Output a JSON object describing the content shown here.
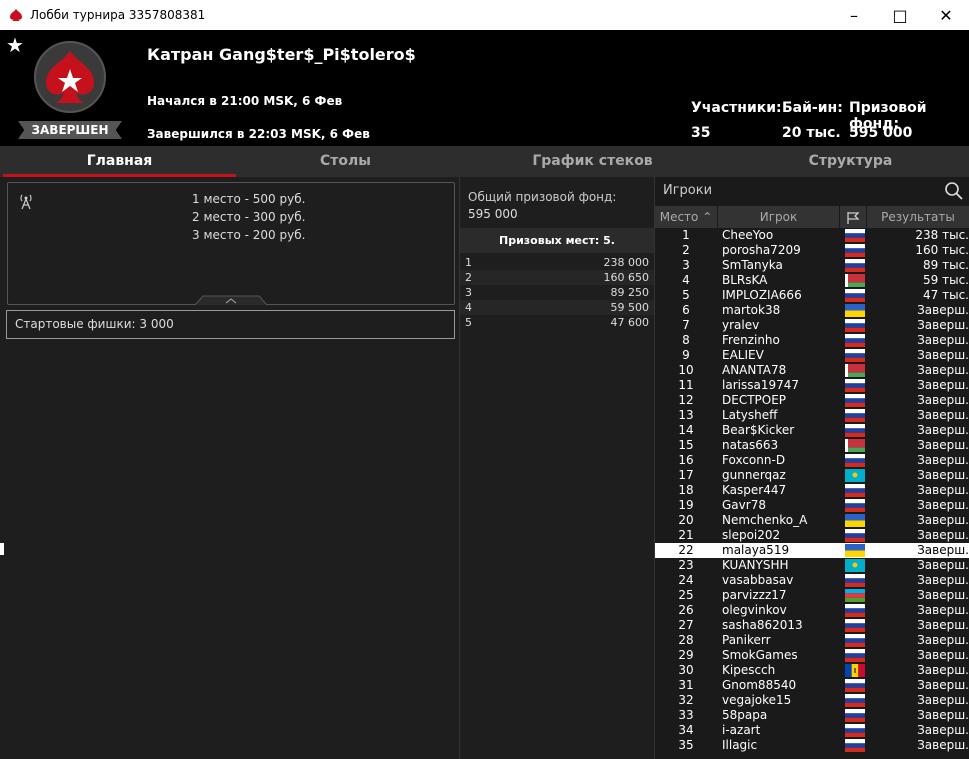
{
  "window": {
    "title": "Лобби турнира 3357808381"
  },
  "tournament": {
    "name": "Катран Gang$ter$_Pi$tolero$",
    "status": "ЗАВЕРШЕН",
    "started": "Начался в 21:00 MSK, 6 Фев",
    "ended": "Завершился в 22:03 MSK, 6 Фев",
    "participants_label": "Участники:",
    "participants": "35",
    "buyin_label": "Бай-ин:",
    "buyin": "20 тыс.",
    "prizepool_label": "Призовой фонд:",
    "prizepool": "595 000"
  },
  "tabs": [
    "Главная",
    "Столы",
    "График стеков",
    "Структура"
  ],
  "main": {
    "prizes": [
      "1 место - 500 руб.",
      "2 место - 300 руб.",
      "3 место - 200 руб."
    ],
    "chips_label": "Стартовые фишки:",
    "chips_value": "3 000"
  },
  "prizepool_panel": {
    "label": "Общий призовой фонд:",
    "value": "595 000",
    "places": "Призовых мест: 5.",
    "rows": [
      [
        "1",
        "238 000"
      ],
      [
        "2",
        "160 650"
      ],
      [
        "3",
        "89 250"
      ],
      [
        "4",
        "59 500"
      ],
      [
        "5",
        "47 600"
      ]
    ]
  },
  "players_panel": {
    "title": "Игроки",
    "columns": [
      "Место",
      "Игрок",
      "Результаты"
    ],
    "rows": [
      {
        "place": "1",
        "name": "CheeYoo",
        "flag": "ru",
        "result": "238 тыс."
      },
      {
        "place": "2",
        "name": "porosha7209",
        "flag": "ru",
        "result": "160 тыс."
      },
      {
        "place": "3",
        "name": "SmTanyka",
        "flag": "ru",
        "result": "89 тыс."
      },
      {
        "place": "4",
        "name": "BLRsKA",
        "flag": "by",
        "result": "59 тыс."
      },
      {
        "place": "5",
        "name": "IMPLOZIA666",
        "flag": "ru",
        "result": "47 тыс."
      },
      {
        "place": "6",
        "name": "martok38",
        "flag": "ua",
        "result": "Заверш."
      },
      {
        "place": "7",
        "name": "yralev",
        "flag": "ru",
        "result": "Заверш."
      },
      {
        "place": "8",
        "name": "Frenzinho",
        "flag": "ru",
        "result": "Заверш."
      },
      {
        "place": "9",
        "name": "EALIEV",
        "flag": "ru",
        "result": "Заверш."
      },
      {
        "place": "10",
        "name": "ANANTA78",
        "flag": "by",
        "result": "Заверш."
      },
      {
        "place": "11",
        "name": "larissa19747",
        "flag": "ru",
        "result": "Заверш."
      },
      {
        "place": "12",
        "name": "DECTPOEP",
        "flag": "ru",
        "result": "Заверш."
      },
      {
        "place": "13",
        "name": "Latysheff",
        "flag": "ru",
        "result": "Заверш."
      },
      {
        "place": "14",
        "name": "Bear$Kicker",
        "flag": "ru",
        "result": "Заверш."
      },
      {
        "place": "15",
        "name": "natas663",
        "flag": "by",
        "result": "Заверш."
      },
      {
        "place": "16",
        "name": "Foxconn-D",
        "flag": "ru",
        "result": "Заверш."
      },
      {
        "place": "17",
        "name": "gunnerqaz",
        "flag": "kz",
        "result": "Заверш."
      },
      {
        "place": "18",
        "name": "Kasper447",
        "flag": "ru",
        "result": "Заверш."
      },
      {
        "place": "19",
        "name": "Gavr78",
        "flag": "ru",
        "result": "Заверш."
      },
      {
        "place": "20",
        "name": "Nemchenko_A",
        "flag": "ua",
        "result": "Заверш."
      },
      {
        "place": "21",
        "name": "slepoi202",
        "flag": "ru",
        "result": "Заверш."
      },
      {
        "place": "22",
        "name": "malaya519",
        "flag": "ua",
        "result": "Заверш."
      },
      {
        "place": "23",
        "name": "KUANYSHH",
        "flag": "kz",
        "result": "Заверш."
      },
      {
        "place": "24",
        "name": "vasabbasav",
        "flag": "ru",
        "result": "Заверш."
      },
      {
        "place": "25",
        "name": "parvizzz17",
        "flag": "az",
        "result": "Заверш."
      },
      {
        "place": "26",
        "name": "olegvinkov",
        "flag": "ru",
        "result": "Заверш."
      },
      {
        "place": "27",
        "name": "sasha862013",
        "flag": "ru",
        "result": "Заверш."
      },
      {
        "place": "28",
        "name": "Panikerr",
        "flag": "ru",
        "result": "Заверш."
      },
      {
        "place": "29",
        "name": "SmokGames",
        "flag": "ru",
        "result": "Заверш."
      },
      {
        "place": "30",
        "name": "Kipescch",
        "flag": "md",
        "result": "Заверш."
      },
      {
        "place": "31",
        "name": "Gnom88540",
        "flag": "ru",
        "result": "Заверш."
      },
      {
        "place": "32",
        "name": "vegajoke15",
        "flag": "ru",
        "result": "Заверш."
      },
      {
        "place": "33",
        "name": "58papa",
        "flag": "ru",
        "result": "Заверш."
      },
      {
        "place": "34",
        "name": "i-azart",
        "flag": "ru",
        "result": "Заверш."
      },
      {
        "place": "35",
        "name": "Illagic",
        "flag": "ru",
        "result": "Заверш."
      }
    ]
  },
  "colors": {
    "accent": "#c4111b",
    "highlight": "#ffffff"
  }
}
